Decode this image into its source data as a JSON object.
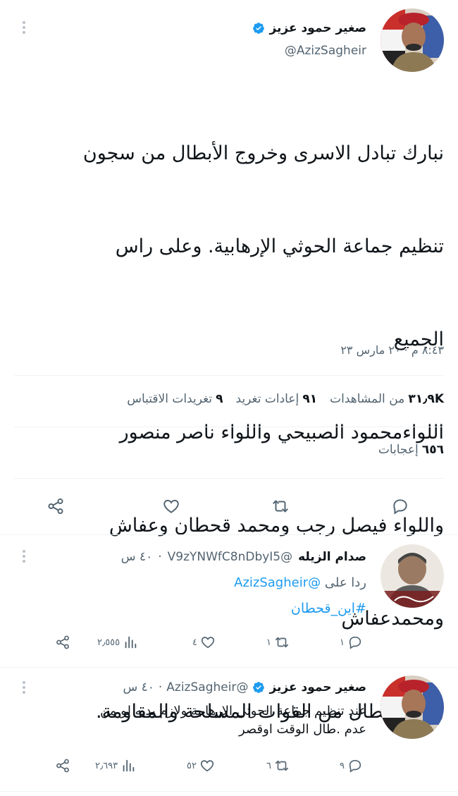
{
  "main_tweet": {
    "author_name": "صغير حمود عزيز",
    "author_handle": "@AzizSagheir",
    "text_lines": [
      "نبارك تبادل الاسرى وخروج الأبطال من سجون",
      "تنظيم جماعة الحوثي الإرهابية. وعلى راس",
      "الجميع",
      "اللواءمحمود الصبيحي واللواء ناصر منصور",
      "واللواء فيصل رجب ومحمد قحطان وعفاش",
      "ومحمدعفاش",
      "وكل الأبطال من القوات المسلحة والمقاومة."
    ],
    "timestamp": "٨:٤٣ م · ٢٠ مارس ٢٣",
    "stats": {
      "views_count": "٣١٫٩K",
      "views_label": "من المشاهدات",
      "retweets_count": "٩١",
      "retweets_label": "إعادات تغريد",
      "quotes_count": "٩",
      "quotes_label": "تغريدات الاقتباس",
      "likes_count": "٦٥٦",
      "likes_label": "إعجابات"
    }
  },
  "replies": [
    {
      "author_name": "صدام الزيله",
      "author_handle": "@V9zYNWfC8nDbyI5",
      "time": "٤٠ س",
      "replying_prefix": "ردا على",
      "replying_to": "@AzizSagheir",
      "text": "#اين_قحطان",
      "replies": "١",
      "retweets": "١",
      "likes": "٤",
      "views": "٢٫٥٥٥"
    },
    {
      "author_name": "صغير حمود عزيز",
      "author_handle": "@AzizSagheir",
      "time": "٤٠ س",
      "text_lines": [
        "عند تنظيم جماعة  الحوثي الإرهابية ولازم يديه لو من",
        "عدم .طال الوقت اوقصر"
      ],
      "replies": "٩",
      "retweets": "٦",
      "likes": "٥٢",
      "views": "٢٫٦٩٣"
    }
  ],
  "colors": {
    "accent": "#1d9bf0",
    "text": "#0f1419",
    "secondary": "#536471",
    "divider": "#eff3f4"
  }
}
